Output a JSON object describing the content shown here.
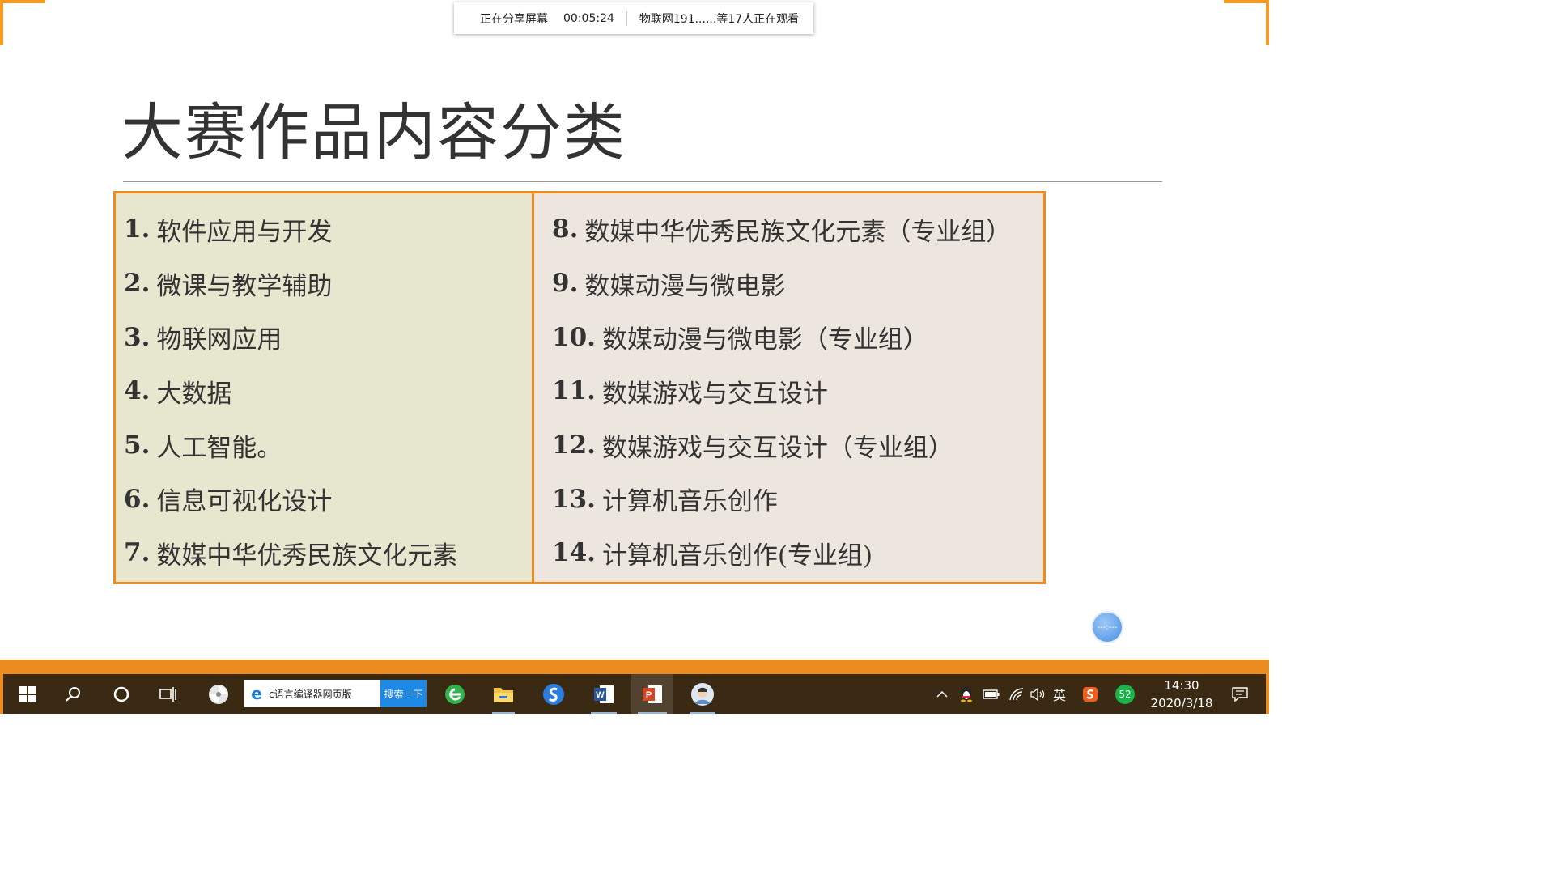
{
  "share_bar": {
    "status": "正在分享屏幕",
    "timer": "00:05:24",
    "viewers": "物联网191......等17人正在观看"
  },
  "slide": {
    "title": "大赛作品内容分类",
    "left_items": [
      {
        "num": "1.",
        "text": "软件应用与开发"
      },
      {
        "num": "2.",
        "text": "微课与教学辅助"
      },
      {
        "num": "3.",
        "text": "物联网应用"
      },
      {
        "num": "4.",
        "text": "大数据"
      },
      {
        "num": "5.",
        "text": "人工智能。"
      },
      {
        "num": "6.",
        "text": "信息可视化设计"
      },
      {
        "num": "7.",
        "text": "数媒中华优秀民族文化元素"
      }
    ],
    "right_items": [
      {
        "num": "8.",
        "text": "数媒中华优秀民族文化元素（专业组）"
      },
      {
        "num": "9.",
        "text": "数媒动漫与微电影"
      },
      {
        "num": "10.",
        "text": "数媒动漫与微电影（专业组）"
      },
      {
        "num": "11.",
        "text": "数媒游戏与交互设计"
      },
      {
        "num": "12.",
        "text": "数媒游戏与交互设计（专业组）"
      },
      {
        "num": "13.",
        "text": "计算机音乐创作"
      },
      {
        "num": "14.",
        "text": "计算机音乐创作(专业组)"
      }
    ]
  },
  "floating_button": {
    "label": "---:---"
  },
  "taskbar": {
    "search_text": "c语言编译器网页版",
    "search_button": "搜索一下",
    "ime_label": "英",
    "notification_badge": "52",
    "time": "14:30",
    "date": "2020/3/18"
  },
  "colors": {
    "accent_orange": "#ec8b1f",
    "left_column_bg": "#e7e6cf",
    "right_column_bg": "#ede6de",
    "taskbar_bg": "#3a2a14"
  }
}
